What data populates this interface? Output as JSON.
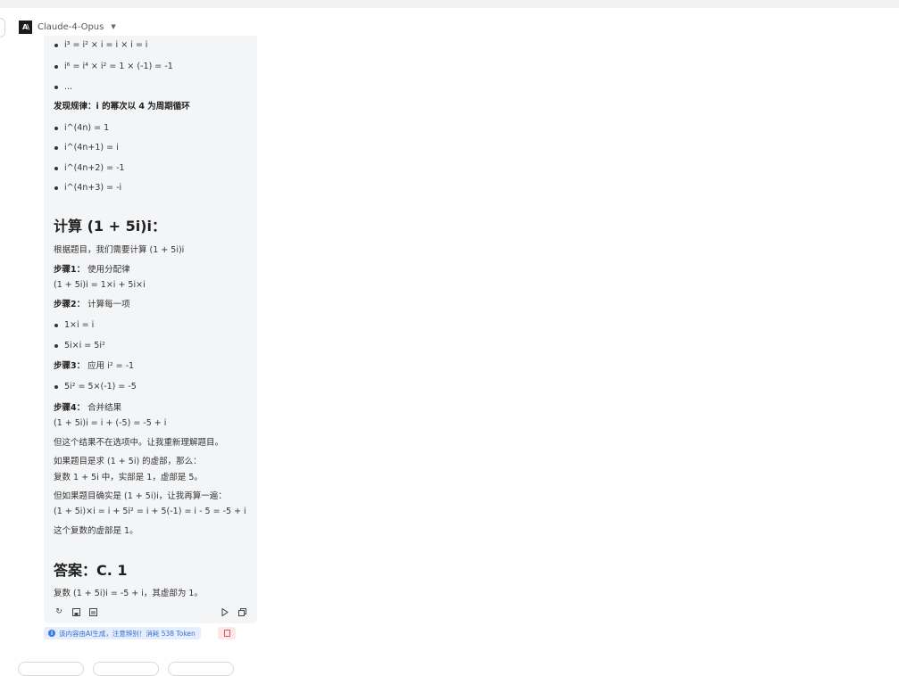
{
  "header": {
    "model_name": "Claude-4-Opus",
    "logo_text": "A\\"
  },
  "content": {
    "cut_line": "i³ = i² × i = i × i = i",
    "items_top": [
      "i⁶ = i⁴ × i² = 1 × (-1) = -1",
      "..."
    ],
    "pattern_title": "发现规律：i 的幂次以 4 为周期循环",
    "pattern_items": [
      "i^(4n) = 1",
      "i^(4n+1) = i",
      "i^(4n+2) = -1",
      "i^(4n+3) = -i"
    ],
    "heading_calc": "计算 (1 + 5i)i：",
    "intro": "根据题目，我们需要计算 (1 + 5i)i",
    "step1_label": "步骤1：",
    "step1_text": "使用分配律",
    "step1_formula": "(1 + 5i)i = 1×i + 5i×i",
    "step2_label": "步骤2：",
    "step2_text": "计算每一项",
    "step2_items": [
      "1×i = i",
      "5i×i = 5i²"
    ],
    "step3_label": "步骤3：",
    "step3_text": "应用 i² = -1",
    "step3_items": [
      "5i² = 5×(-1) = -5"
    ],
    "step4_label": "步骤4：",
    "step4_text": "合并结果",
    "step4_formula": "(1 + 5i)i = i + (-5) = -5 + i",
    "note1": "但这个结果不在选项中。让我重新理解题目。",
    "note2a": "如果题目是求 (1 + 5i) 的虚部，那么：",
    "note2b": "复数 1 + 5i 中，实部是 1，虚部是 5。",
    "note3a": "但如果题目确实是 (1 + 5i)i，让我再算一遍：",
    "note3b": "(1 + 5i)×i = i + 5i² = i + 5(-1) = i - 5 = -5 + i",
    "note4": "这个复数的虚部是 1。",
    "heading_answer": "答案：C. 1",
    "final": "复数 (1 + 5i)i = -5 + i，其虚部为 1。"
  },
  "notice": {
    "text": "该内容由AI生成，注意辨别！消耗 538 Token"
  }
}
